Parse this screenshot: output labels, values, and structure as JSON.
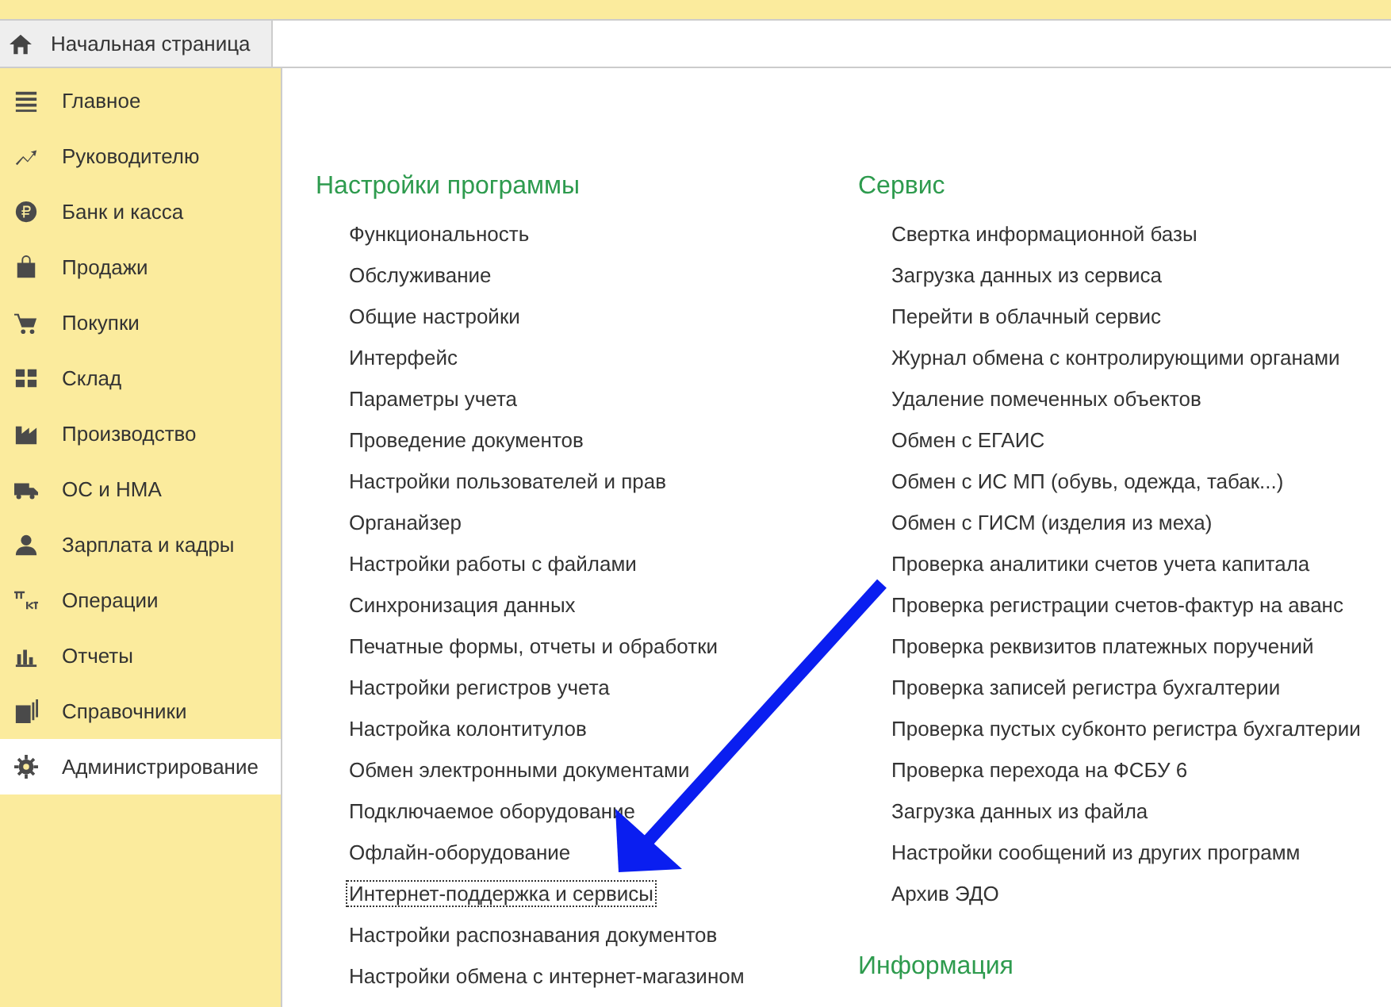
{
  "home_tab": {
    "label": "Начальная страница"
  },
  "sidebar": {
    "items": [
      {
        "label": "Главное",
        "selected": false
      },
      {
        "label": "Руководителю",
        "selected": false
      },
      {
        "label": "Банк и касса",
        "selected": false
      },
      {
        "label": "Продажи",
        "selected": false
      },
      {
        "label": "Покупки",
        "selected": false
      },
      {
        "label": "Склад",
        "selected": false
      },
      {
        "label": "Производство",
        "selected": false
      },
      {
        "label": "ОС и НМА",
        "selected": false
      },
      {
        "label": "Зарплата и кадры",
        "selected": false
      },
      {
        "label": "Операции",
        "selected": false
      },
      {
        "label": "Отчеты",
        "selected": false
      },
      {
        "label": "Справочники",
        "selected": false
      },
      {
        "label": "Администрирование",
        "selected": true
      }
    ]
  },
  "columns": [
    {
      "sections": [
        {
          "title": "Настройки программы",
          "links": [
            {
              "label": "Функциональность",
              "focused": false
            },
            {
              "label": "Обслуживание",
              "focused": false
            },
            {
              "label": "Общие настройки",
              "focused": false
            },
            {
              "label": "Интерфейс",
              "focused": false
            },
            {
              "label": "Параметры учета",
              "focused": false
            },
            {
              "label": "Проведение документов",
              "focused": false
            },
            {
              "label": "Настройки пользователей и прав",
              "focused": false
            },
            {
              "label": "Органайзер",
              "focused": false
            },
            {
              "label": "Настройки работы с файлами",
              "focused": false
            },
            {
              "label": "Синхронизация данных",
              "focused": false
            },
            {
              "label": "Печатные формы, отчеты и обработки",
              "focused": false
            },
            {
              "label": "Настройки регистров учета",
              "focused": false
            },
            {
              "label": "Настройка колонтитулов",
              "focused": false
            },
            {
              "label": "Обмен электронными документами",
              "focused": false
            },
            {
              "label": "Подключаемое оборудование",
              "focused": false
            },
            {
              "label": "Офлайн-оборудование",
              "focused": false
            },
            {
              "label": "Интернет-поддержка и сервисы",
              "focused": true
            },
            {
              "label": "Настройки распознавания документов",
              "focused": false
            },
            {
              "label": "Настройки обмена с интернет-магазином",
              "focused": false
            }
          ]
        }
      ]
    },
    {
      "sections": [
        {
          "title": "Сервис",
          "links": [
            {
              "label": "Свертка информационной базы",
              "focused": false
            },
            {
              "label": "Загрузка данных из сервиса",
              "focused": false
            },
            {
              "label": "Перейти в облачный сервис",
              "focused": false
            },
            {
              "label": "Журнал обмена с контролирующими органами",
              "focused": false
            },
            {
              "label": "Удаление помеченных объектов",
              "focused": false
            },
            {
              "label": "Обмен с ЕГАИС",
              "focused": false
            },
            {
              "label": "Обмен с ИС МП (обувь, одежда, табак...)",
              "focused": false
            },
            {
              "label": "Обмен с ГИСМ (изделия из меха)",
              "focused": false
            },
            {
              "label": "Проверка аналитики счетов учета капитала",
              "focused": false
            },
            {
              "label": "Проверка регистрации счетов-фактур на аванс",
              "focused": false
            },
            {
              "label": "Проверка реквизитов платежных поручений",
              "focused": false
            },
            {
              "label": "Проверка записей регистра бухгалтерии",
              "focused": false
            },
            {
              "label": "Проверка пустых субконто регистра бухгалтерии",
              "focused": false
            },
            {
              "label": "Проверка перехода на ФСБУ 6",
              "focused": false
            },
            {
              "label": "Загрузка данных из файла",
              "focused": false
            },
            {
              "label": "Настройки сообщений из других программ",
              "focused": false
            },
            {
              "label": "Архив ЭДО",
              "focused": false
            }
          ]
        },
        {
          "title": "Информация"
        }
      ]
    }
  ]
}
